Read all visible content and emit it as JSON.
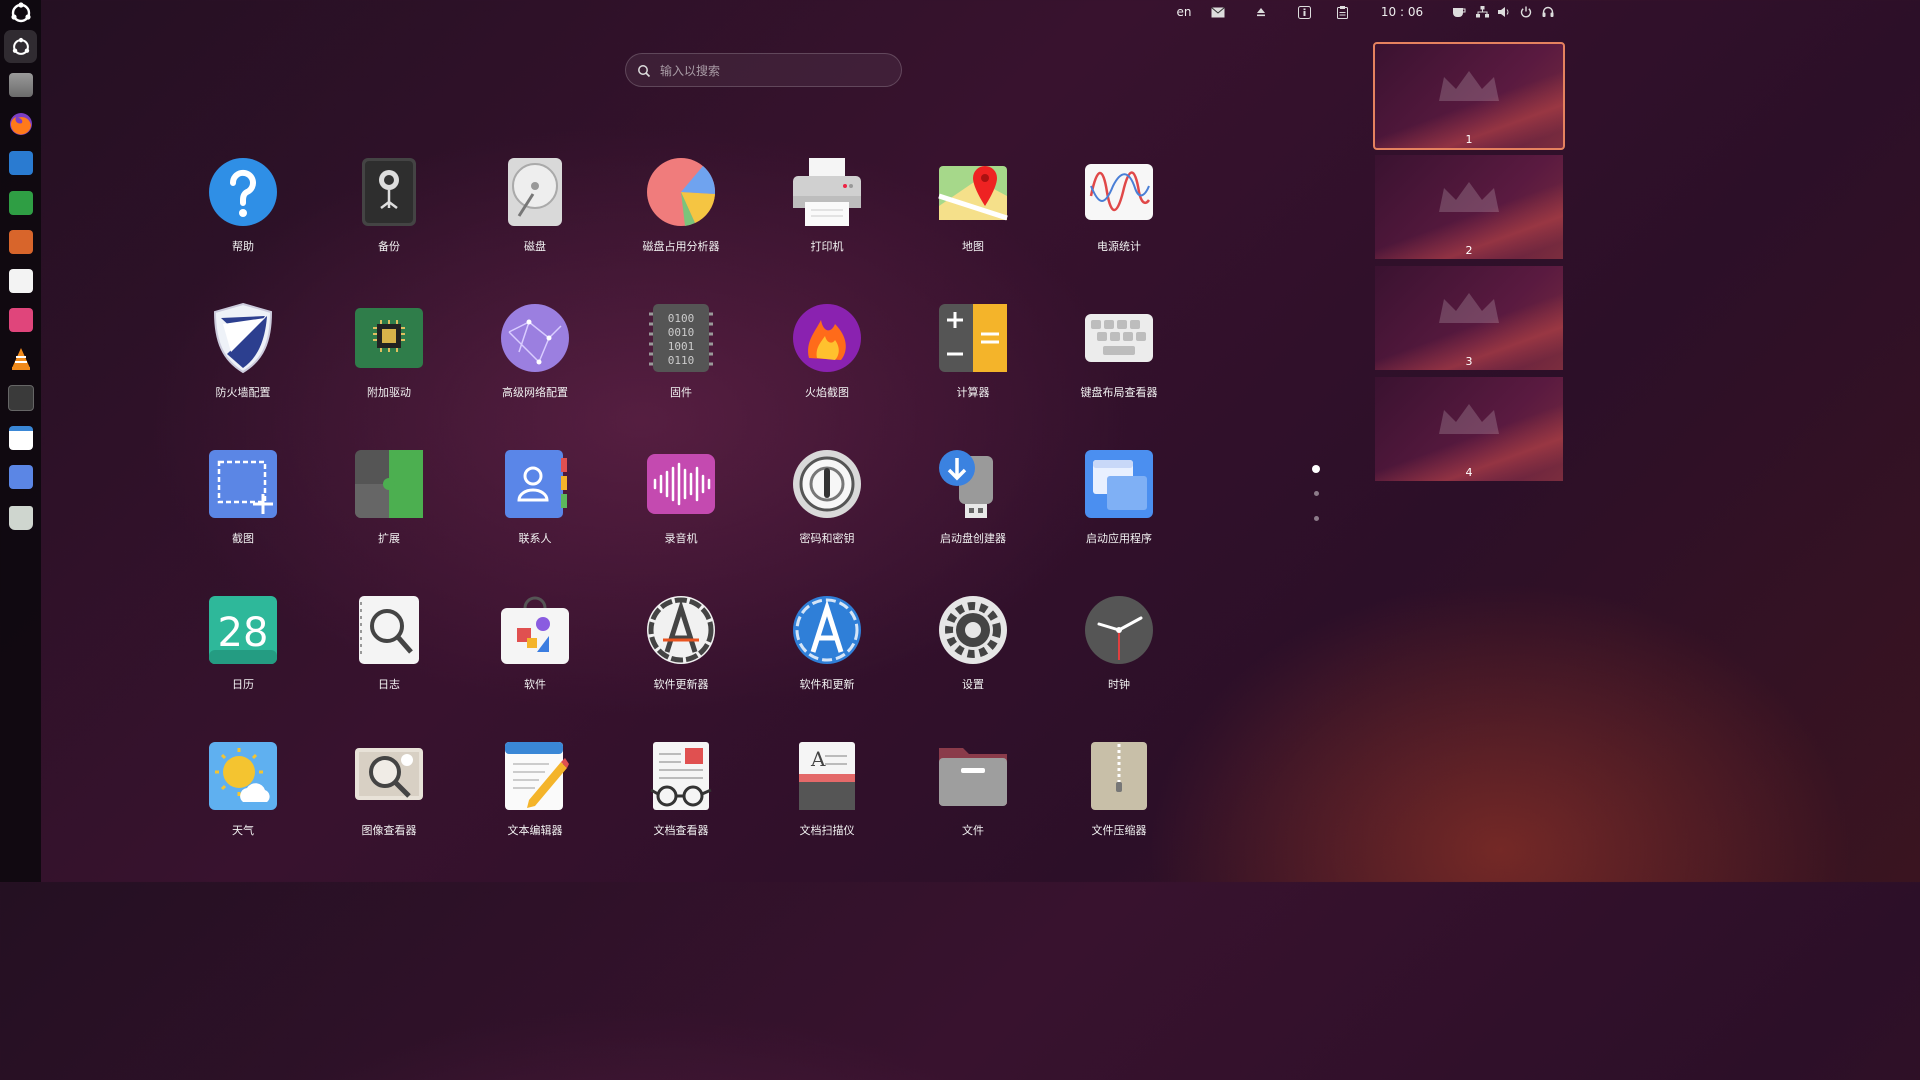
{
  "topbar": {
    "language": "en",
    "clock": "10 : 06"
  },
  "search": {
    "placeholder": "输入以搜索"
  },
  "apps": [
    {
      "label": "帮助",
      "icon": "help-icon"
    },
    {
      "label": "备份",
      "icon": "backup-icon"
    },
    {
      "label": "磁盘",
      "icon": "disks-icon"
    },
    {
      "label": "磁盘占用分析器",
      "icon": "disk-usage-analyzer-icon"
    },
    {
      "label": "打印机",
      "icon": "printer-icon"
    },
    {
      "label": "地图",
      "icon": "maps-icon"
    },
    {
      "label": "电源统计",
      "icon": "power-statistics-icon"
    },
    {
      "label": "防火墙配置",
      "icon": "firewall-icon"
    },
    {
      "label": "附加驱动",
      "icon": "additional-drivers-icon"
    },
    {
      "label": "高级网络配置",
      "icon": "network-config-icon"
    },
    {
      "label": "固件",
      "icon": "firmware-icon"
    },
    {
      "label": "火焰截图",
      "icon": "flameshot-icon"
    },
    {
      "label": "计算器",
      "icon": "calculator-icon"
    },
    {
      "label": "键盘布局查看器",
      "icon": "keyboard-layout-icon"
    },
    {
      "label": "截图",
      "icon": "screenshot-icon"
    },
    {
      "label": "扩展",
      "icon": "extensions-icon"
    },
    {
      "label": "联系人",
      "icon": "contacts-icon"
    },
    {
      "label": "录音机",
      "icon": "sound-recorder-icon"
    },
    {
      "label": "密码和密钥",
      "icon": "passwords-keys-icon"
    },
    {
      "label": "启动盘创建器",
      "icon": "startup-disk-creator-icon"
    },
    {
      "label": "启动应用程序",
      "icon": "startup-applications-icon"
    },
    {
      "label": "日历",
      "icon": "calendar-icon",
      "text": "28"
    },
    {
      "label": "日志",
      "icon": "logs-icon"
    },
    {
      "label": "软件",
      "icon": "software-icon"
    },
    {
      "label": "软件更新器",
      "icon": "software-updater-icon"
    },
    {
      "label": "软件和更新",
      "icon": "software-updates-icon"
    },
    {
      "label": "设置",
      "icon": "settings-icon"
    },
    {
      "label": "时钟",
      "icon": "clocks-icon"
    },
    {
      "label": "天气",
      "icon": "weather-icon"
    },
    {
      "label": "图像查看器",
      "icon": "image-viewer-icon"
    },
    {
      "label": "文本编辑器",
      "icon": "text-editor-icon"
    },
    {
      "label": "文档查看器",
      "icon": "document-viewer-icon"
    },
    {
      "label": "文档扫描仪",
      "icon": "document-scanner-icon"
    },
    {
      "label": "文件",
      "icon": "files-icon"
    },
    {
      "label": "文件压缩器",
      "icon": "file-roller-icon"
    }
  ],
  "workspaces": [
    {
      "number": "1",
      "selected": true
    },
    {
      "number": "2",
      "selected": false
    },
    {
      "number": "3",
      "selected": false
    },
    {
      "number": "4",
      "selected": false
    }
  ],
  "pages": {
    "current": 1,
    "total": 3
  },
  "colors": {
    "accent": "#e5825f",
    "ubuntu_orange": "#e95420"
  }
}
